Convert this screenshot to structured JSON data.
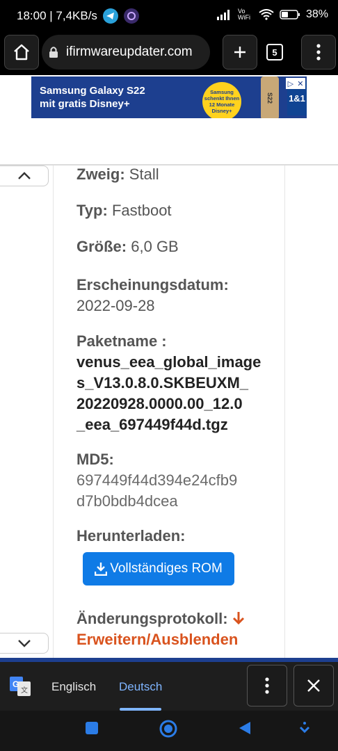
{
  "status": {
    "time_speed": "18:00 | 7,4KB/s",
    "network": "Vo WiFi",
    "battery": "38%"
  },
  "browser": {
    "url": "ifirmwareupdater.com",
    "tab_count": "5"
  },
  "ad": {
    "headline_1": "Samsung Galaxy S22",
    "headline_2": "mit gratis Disney+",
    "badge_1": "Samsung",
    "badge_2": "schenkt Ihnen",
    "badge_3": "12 Monate",
    "badge_4": "Disney+",
    "phone_label": "S22",
    "logo": "1&1"
  },
  "content": {
    "branch_label": "Zweig:",
    "branch_value": "Stall",
    "type_label": "Typ:",
    "type_value": "Fastboot",
    "size_label": "Größe:",
    "size_value": "6,0 GB",
    "date_label": "Erscheinungsdatum:",
    "date_value": "2022-09-28",
    "package_label": "Paketname :",
    "package_value_lines": [
      "venus_eea_global_image",
      "s_V13.0.8.0.SKBEUXM_",
      "20220928.0000.00_12.0",
      "_eea_697449f44d.tgz"
    ],
    "md5_label": "MD5:",
    "md5_value_lines": [
      "697449f44d394e24cfb9",
      "d7b0bdb4dcea"
    ],
    "download_label": "Herunterladen:",
    "download_button": "Vollständiges ROM",
    "changelog_label": "Änderungsprotokoll:",
    "changelog_toggle": "Erweitern/Ausblenden"
  },
  "translate": {
    "source_lang": "Englisch",
    "target_lang": "Deutsch"
  },
  "colors": {
    "accent_blue": "#0f7be6",
    "changelog_orange": "#d9531e",
    "deutsch_blue": "#7fb5ff"
  }
}
